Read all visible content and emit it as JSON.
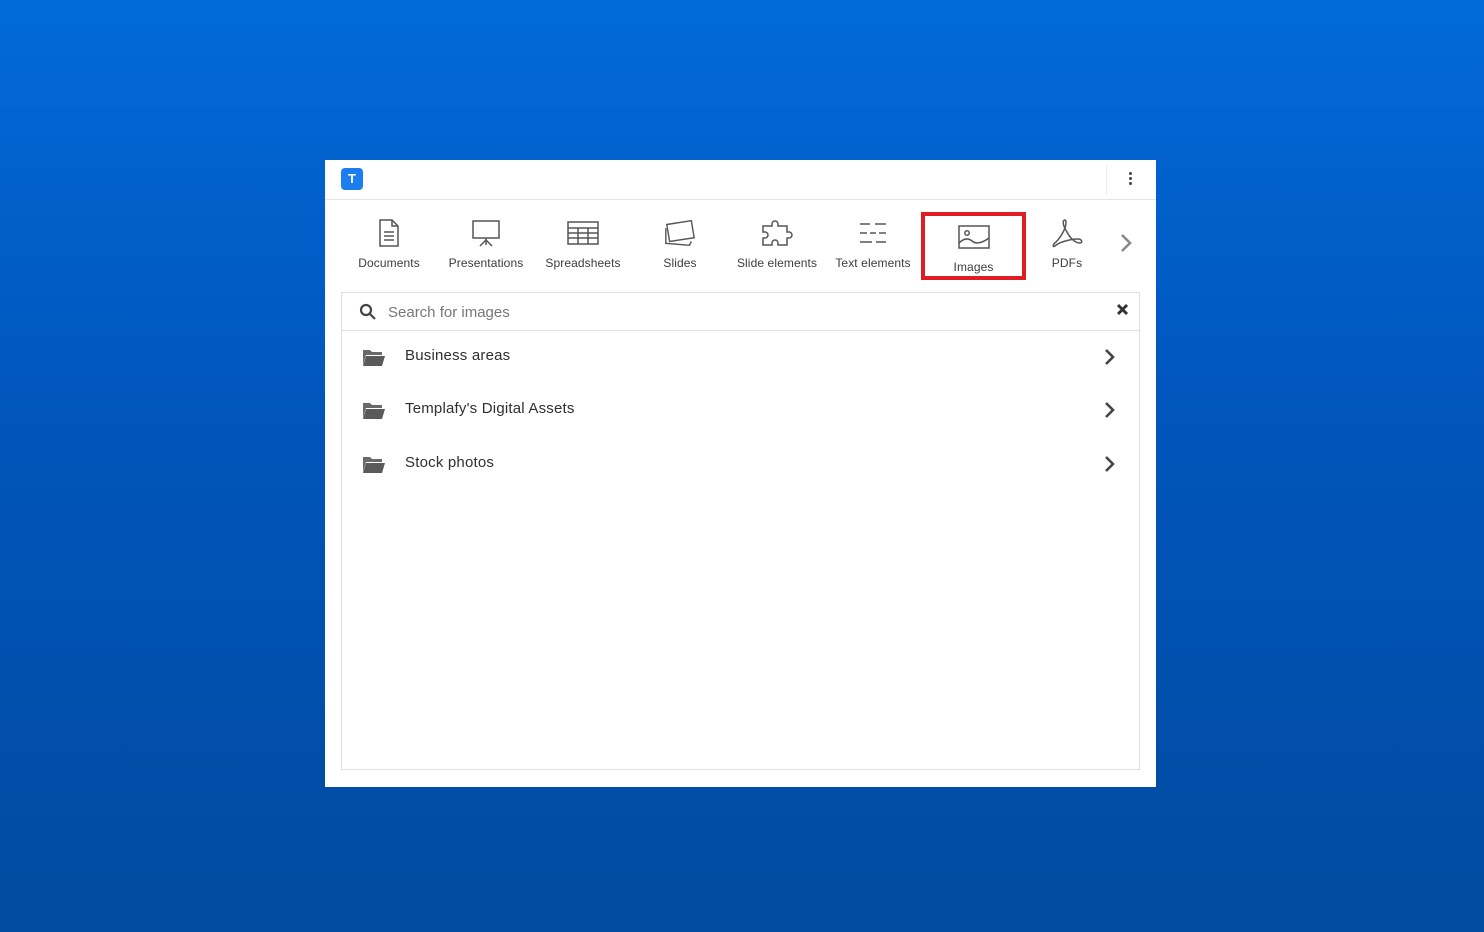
{
  "app": {
    "logo_letter": "T",
    "brand_color": "#1a7df0",
    "highlight_color": "#e01c24"
  },
  "categories": [
    {
      "label": "Documents",
      "icon": "document-icon"
    },
    {
      "label": "Presentations",
      "icon": "presentation-icon"
    },
    {
      "label": "Spreadsheets",
      "icon": "spreadsheet-icon"
    },
    {
      "label": "Slides",
      "icon": "slides-icon"
    },
    {
      "label": "Slide elements",
      "icon": "puzzle-icon"
    },
    {
      "label": "Text elements",
      "icon": "text-elements-icon"
    },
    {
      "label": "Images",
      "icon": "image-icon",
      "selected": true
    },
    {
      "label": "PDFs",
      "icon": "pdf-icon"
    }
  ],
  "search": {
    "placeholder": "Search for images",
    "value": ""
  },
  "folders": [
    {
      "label": "Business areas"
    },
    {
      "label": "Templafy's Digital Assets"
    },
    {
      "label": "Stock photos"
    }
  ]
}
